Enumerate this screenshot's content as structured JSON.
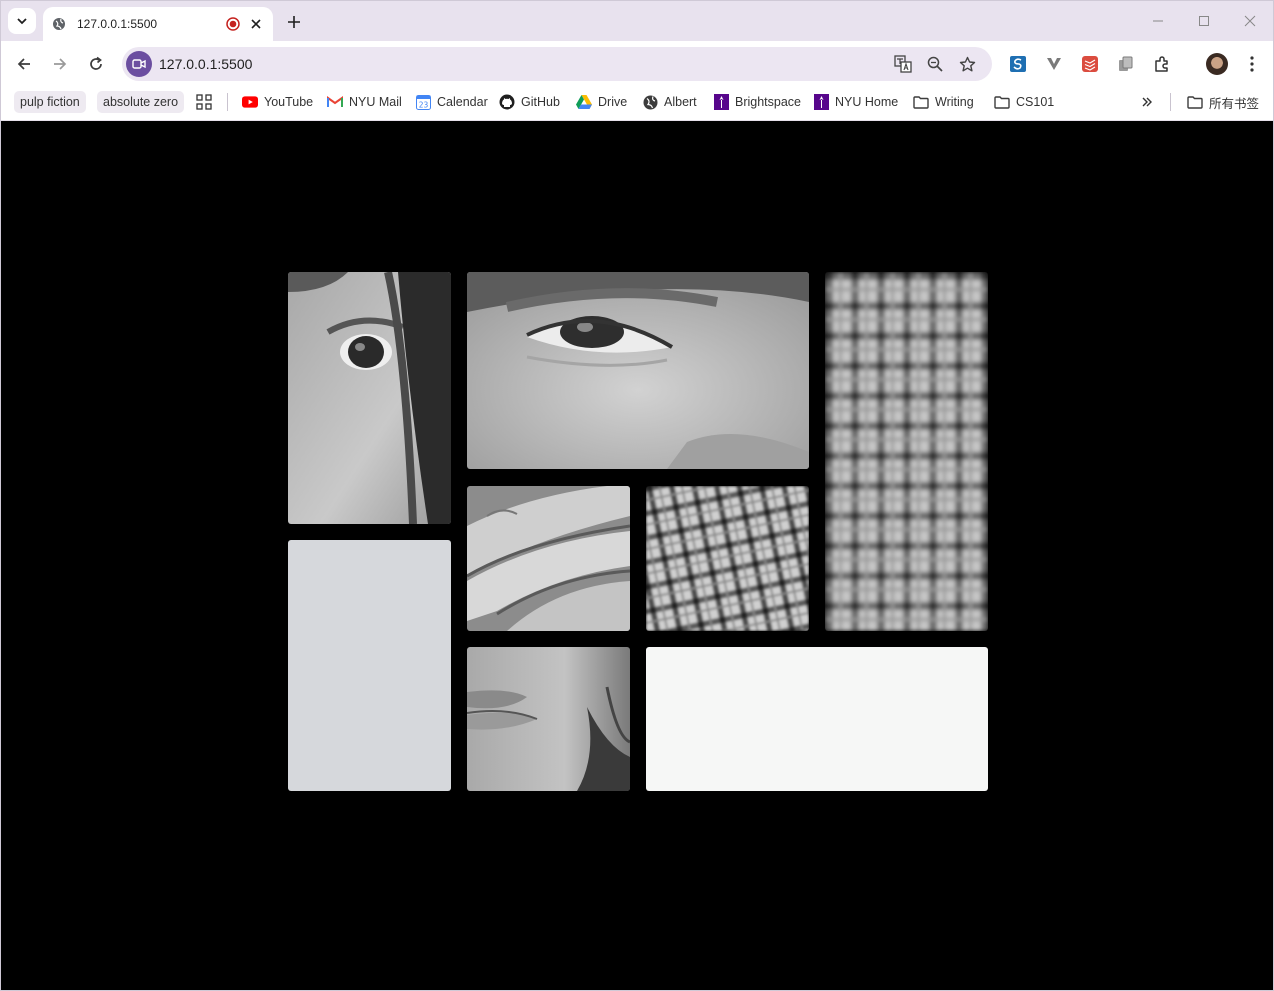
{
  "browser": {
    "tab": {
      "title": "127.0.0.1:5500"
    },
    "address_bar": {
      "url": "127.0.0.1:5500"
    }
  },
  "bookmarks": {
    "chips": [
      "pulp fiction",
      "absolute zero"
    ],
    "items": [
      {
        "label": "YouTube",
        "icon": "youtube-icon"
      },
      {
        "label": "NYU Mail",
        "icon": "gmail-icon"
      },
      {
        "label": "Calendar",
        "icon": "calendar-icon"
      },
      {
        "label": "GitHub",
        "icon": "github-icon"
      },
      {
        "label": "Drive",
        "icon": "drive-icon"
      },
      {
        "label": "Albert",
        "icon": "globe-icon"
      },
      {
        "label": "Brightspace",
        "icon": "nyu-torch-icon"
      },
      {
        "label": "NYU Home",
        "icon": "nyu-torch-icon"
      },
      {
        "label": "Writing",
        "icon": "folder-icon"
      },
      {
        "label": "CS101",
        "icon": "folder-icon"
      }
    ],
    "all_bookmarks": "所有书签"
  },
  "gallery": {
    "tiles": [
      {
        "name": "photo-eye-hair",
        "kind": "grayscale photo"
      },
      {
        "name": "photo-eye-close",
        "kind": "grayscale photo"
      },
      {
        "name": "photo-plaid-tall",
        "kind": "grayscale photo"
      },
      {
        "name": "photo-hand",
        "kind": "grayscale photo"
      },
      {
        "name": "photo-plaid-small",
        "kind": "grayscale photo"
      },
      {
        "name": "blank-tile-gray",
        "kind": "solid",
        "color": "#d6d8dc"
      },
      {
        "name": "photo-lips",
        "kind": "grayscale photo"
      },
      {
        "name": "blank-tile-white",
        "kind": "solid",
        "color": "#f6f7f6"
      }
    ]
  }
}
